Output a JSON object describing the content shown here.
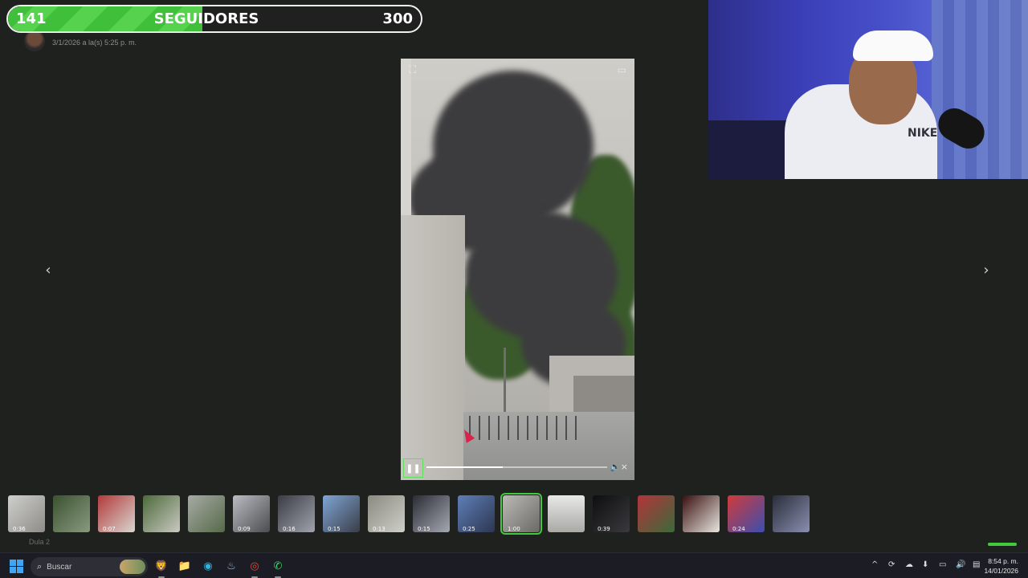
{
  "message": {
    "timestamp": "3/1/2026 a la(s) 5:25 p. m."
  },
  "goal": {
    "current": "141",
    "label": "SEGUIDORES",
    "target": "300",
    "progress": 0.47,
    "bar_color": "#42c93d"
  },
  "viewer": {
    "prev_icon": "chevron-left-icon",
    "prev_glyph": "‹",
    "next_icon": "chevron-right-icon",
    "next_glyph": "›",
    "expand_glyph": "⛶",
    "pip_glyph": "▭",
    "pause_glyph": "❚❚",
    "mute_glyph": "🔈×",
    "playback_progress": 0.42,
    "accent_color": "#42c93d"
  },
  "webcam": {
    "shirt_logo": "NIKE"
  },
  "thumbnails": [
    {
      "duration": "0:36",
      "bg": "linear-gradient(135deg,#cfcfcb,#8d8c88)"
    },
    {
      "duration": "",
      "bg": "linear-gradient(135deg,#3a5230,#8a9a80)"
    },
    {
      "duration": "0:07",
      "bg": "linear-gradient(135deg,#b33a3a,#d8d6d0)"
    },
    {
      "duration": "",
      "bg": "linear-gradient(135deg,#4d6a3a,#c9c9c2)"
    },
    {
      "duration": "",
      "bg": "linear-gradient(135deg,#a7aaa4,#566a4a)"
    },
    {
      "duration": "0:09",
      "bg": "linear-gradient(135deg,#b9bcc0,#4a4c50)"
    },
    {
      "duration": "0:16",
      "bg": "linear-gradient(135deg,#3a3c44,#9fa3ab)"
    },
    {
      "duration": "0:15",
      "bg": "linear-gradient(135deg,#7fa6d6,#3a3d46)"
    },
    {
      "duration": "0:13",
      "bg": "linear-gradient(135deg,#8a8a80,#cfcfca)"
    },
    {
      "duration": "0:15",
      "bg": "linear-gradient(135deg,#2a2c34,#a5a9b3)"
    },
    {
      "duration": "0:25",
      "bg": "linear-gradient(135deg,#5d7fb8,#2e3650)"
    },
    {
      "duration": "1:00",
      "bg": "linear-gradient(135deg,#bcbab5,#6a6966)",
      "active": true
    },
    {
      "duration": "",
      "bg": "linear-gradient(180deg,#e8e8e6,#a9a9a6)"
    },
    {
      "duration": "0:39",
      "bg": "linear-gradient(135deg,#0e0e10,#3a3a3e)"
    },
    {
      "duration": "",
      "bg": "linear-gradient(135deg,#b2353a,#3b6a3a)"
    },
    {
      "duration": "",
      "bg": "linear-gradient(135deg,#3a1010,#e8e6e0)"
    },
    {
      "duration": "0:24",
      "bg": "linear-gradient(135deg,#d23a3a,#3a4fb0)"
    },
    {
      "duration": "",
      "bg": "linear-gradient(135deg,#2a2d3a,#8a8fb0)"
    }
  ],
  "hidden_row": {
    "label": "Dula 2"
  },
  "taskbar": {
    "search_placeholder": "Buscar",
    "apps": [
      {
        "name": "brave-browser-icon",
        "glyph": "🦁",
        "color": "#fb542b",
        "open": true
      },
      {
        "name": "file-explorer-icon",
        "glyph": "📁",
        "color": "#f2c744",
        "open": false
      },
      {
        "name": "edge-browser-icon",
        "glyph": "◉",
        "color": "#2fb3e0",
        "open": false
      },
      {
        "name": "steam-icon",
        "glyph": "♨",
        "color": "#9ab8d8",
        "open": false
      },
      {
        "name": "chrome-browser-icon",
        "glyph": "◎",
        "color": "#e24a3b",
        "open": true
      },
      {
        "name": "whatsapp-icon",
        "glyph": "✆",
        "color": "#3ed464",
        "open": true
      }
    ],
    "tray": [
      "^",
      "⟳",
      "☁",
      "⬇",
      "▭",
      "🔊",
      "▤"
    ],
    "time": "8:54 p. m.",
    "date": "14/01/2026"
  }
}
